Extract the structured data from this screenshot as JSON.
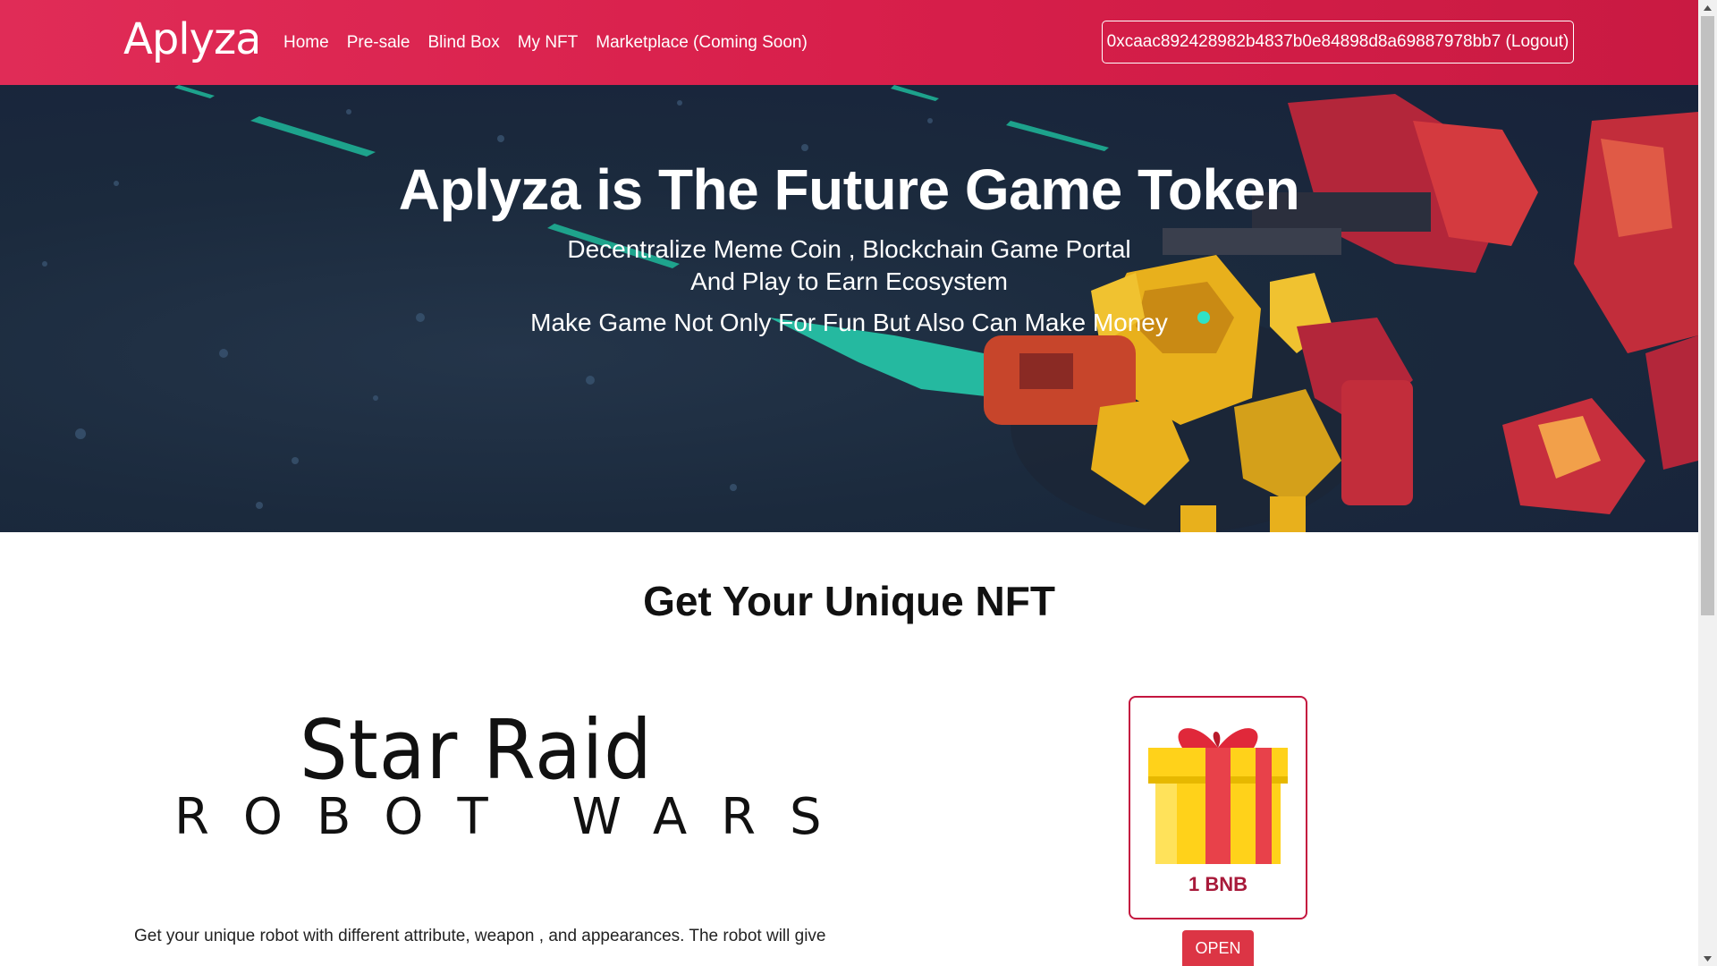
{
  "header": {
    "logo_text": "Aplyza",
    "nav": [
      "Home",
      "Pre-sale",
      "Blind Box",
      "My NFT",
      "Marketplace (Coming Soon)"
    ],
    "wallet_label": "0xcaac892428982b4837b0e84898d8a69887978bb7 (Logout)"
  },
  "hero": {
    "title": "Aplyza is The Future Game Token",
    "subtitle_line1": "Decentralize Meme Coin , Blockchain Game Portal",
    "subtitle_line2": "And Play to Earn Ecosystem",
    "tagline": "Make Game Not Only For Fun But Also Can Make Money"
  },
  "main": {
    "section_title": "Get Your Unique NFT",
    "game_logo_line1": "Star Raid",
    "game_logo_line2": "ROBOT WARS",
    "description": "Get your unique robot with different attribute, weapon , and appearances. The robot will give",
    "box": {
      "price": "1 BNB",
      "open_label": "OPEN"
    }
  },
  "colors": {
    "brand": "#d81f4b",
    "hero_bg": "#1b2a3d",
    "button": "#dc3545"
  }
}
